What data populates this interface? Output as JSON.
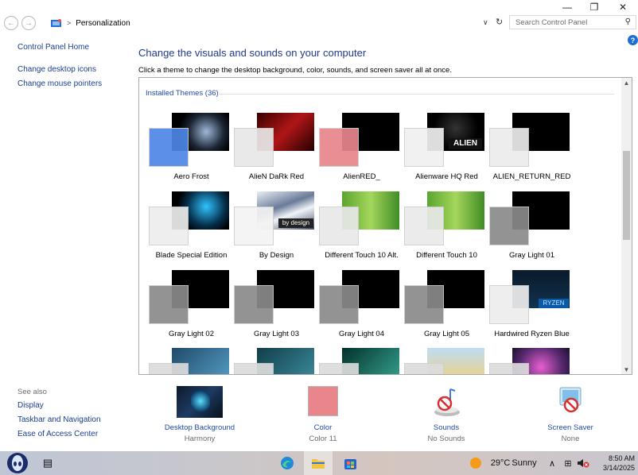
{
  "window": {
    "minimize_glyph": "—",
    "maximize_glyph": "❐",
    "close_glyph": "✕"
  },
  "address": {
    "back_glyph": "←",
    "forward_glyph": "→",
    "location": "Personalization",
    "separator": ">",
    "dropdown_glyph": "∨",
    "refresh_glyph": "↻",
    "search_placeholder": "Search Control Panel",
    "search_glyph": "⚲"
  },
  "help_glyph": "?",
  "sidebar": {
    "home": "Control Panel Home",
    "links": [
      "Change desktop icons",
      "Change mouse pointers"
    ],
    "see_also_label": "See also",
    "see_also": [
      "Display",
      "Taskbar and Navigation",
      "Ease of Access Center"
    ]
  },
  "main": {
    "title": "Change the visuals and sounds on your computer",
    "description": "Click a theme to change the desktop background, color, sounds, and screen saver all at once.",
    "group_label": "Installed Themes (36)",
    "themes": [
      {
        "name": "Aero Frost",
        "swatch": "#4f86e6"
      },
      {
        "name": "AlieN DaRk Red",
        "swatch": "#e8e8e8"
      },
      {
        "name": "AlienRED_",
        "swatch": "#e8868c"
      },
      {
        "name": "Alienware HQ Red",
        "swatch": "#f0f0f0"
      },
      {
        "name": "ALIEN_RETURN_RED",
        "swatch": "#ececec"
      },
      {
        "name": "Blade Special Edition",
        "swatch": "#ededed"
      },
      {
        "name": "By Design",
        "swatch": "#f4f4f4"
      },
      {
        "name": "Different Touch 10 Alt.",
        "swatch": "#e9e9e9"
      },
      {
        "name": "Different Touch 10",
        "swatch": "#eaeaea"
      },
      {
        "name": "Gray Light 01",
        "swatch": "#8a8a8a"
      },
      {
        "name": "Gray Light 02",
        "swatch": "#8a8a8a"
      },
      {
        "name": "Gray Light 03",
        "swatch": "#8a8a8a"
      },
      {
        "name": "Gray Light 04",
        "swatch": "#8a8a8a"
      },
      {
        "name": "Gray Light 05",
        "swatch": "#8a8a8a"
      },
      {
        "name": "Hardwired Ryzen Blue",
        "swatch": "#ededed"
      },
      {
        "name": "",
        "swatch": "#dcdcdc"
      },
      {
        "name": "",
        "swatch": "#dcdcdc"
      },
      {
        "name": "",
        "swatch": "#dcdcdc"
      },
      {
        "name": "",
        "swatch": "#dcdcdc"
      },
      {
        "name": "",
        "swatch": "#dcdcdc"
      }
    ],
    "tile_deco": {
      "alien_text": "ALIEN",
      "bydesign_text": "by design",
      "ryzen_text": "RYZEN"
    }
  },
  "bottom": {
    "items": [
      {
        "label": "Desktop Background",
        "value": "Harmony"
      },
      {
        "label": "Color",
        "value": "Color 11"
      },
      {
        "label": "Sounds",
        "value": "No Sounds"
      },
      {
        "label": "Screen Saver",
        "value": "None"
      }
    ]
  },
  "taskbar": {
    "weather_temp": "29°C",
    "weather_desc": "Sunny",
    "tray_glyph": "∧",
    "time": "8:50 AM",
    "date": "3/14/2025"
  },
  "colors": {
    "link": "#1a3e8f",
    "accent": "#1e4aa8",
    "title": "#1e3a8a"
  }
}
